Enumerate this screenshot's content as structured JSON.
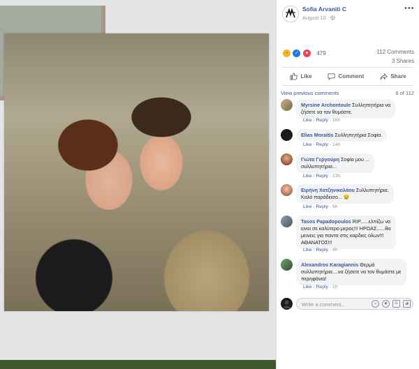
{
  "post": {
    "author": "Sofia Arvaniti C",
    "date": "August 10",
    "reaction_count": "479",
    "comments_count": "112 Comments",
    "shares_count": "3 Shares"
  },
  "actions": {
    "like": "Like",
    "comment": "Comment",
    "share": "Share"
  },
  "comments_header": {
    "view_previous": "View previous comments",
    "page_info": "6 of 112"
  },
  "comments": [
    {
      "name": "Myrsine Archontoule",
      "text_line1": "Συλληπητήρια να",
      "text_line2": "ζήσετε να τον θυμάστε.",
      "like": "Like",
      "reply": "Reply",
      "time": "16h"
    },
    {
      "name": "Elias Moraitis",
      "text_line1": "Συλληπητήρια Σοφία.",
      "like": "Like",
      "reply": "Reply",
      "time": "14h"
    },
    {
      "name": "Γιώτα Γεργούρη",
      "text_line1": "Σοφία μου ...",
      "text_line2": "συλλυπητήρια...",
      "like": "Like",
      "reply": "Reply",
      "time": "13h"
    },
    {
      "name": "Ειρήνη Χατζηνικολάου",
      "text_line1": "Συλλυπητήρια.",
      "text_line2": "Καλό παράδεισο... 😢",
      "like": "Like",
      "reply": "Reply",
      "time": "5h"
    },
    {
      "name": "Tasos Papadopoulos",
      "text_line1": "RIP......ελπίζω να",
      "text_line2": "ειναι σε καλύτερο μερος!!! ΗΡΩΑΣ......θα",
      "text_line3": "μεινεις για παντα στις καρδιες ολων!!!",
      "text_line4": "ΑΘΑΝΑΤΟΣ!!!",
      "like": "Like",
      "reply": "Reply",
      "time": "4h"
    },
    {
      "name": "Alexandros Karagiannis",
      "text_line1": "Θερμά",
      "text_line2": "συλλυπητήρια....να ζήσετε να τον θυμάστε με",
      "text_line3": "περηφάνια!",
      "like": "Like",
      "reply": "Reply",
      "time": "1h"
    }
  ],
  "composer": {
    "placeholder": "Write a comment..."
  },
  "colors": {
    "link_blue": "#385898",
    "bubble_bg": "#f2f3f5",
    "meta_grey": "#90949c"
  },
  "icons": [
    "more-icon",
    "globe-icon",
    "like-icon",
    "comment-icon",
    "share-icon",
    "emoji-icon",
    "camera-icon",
    "gif-icon",
    "sticker-icon"
  ]
}
